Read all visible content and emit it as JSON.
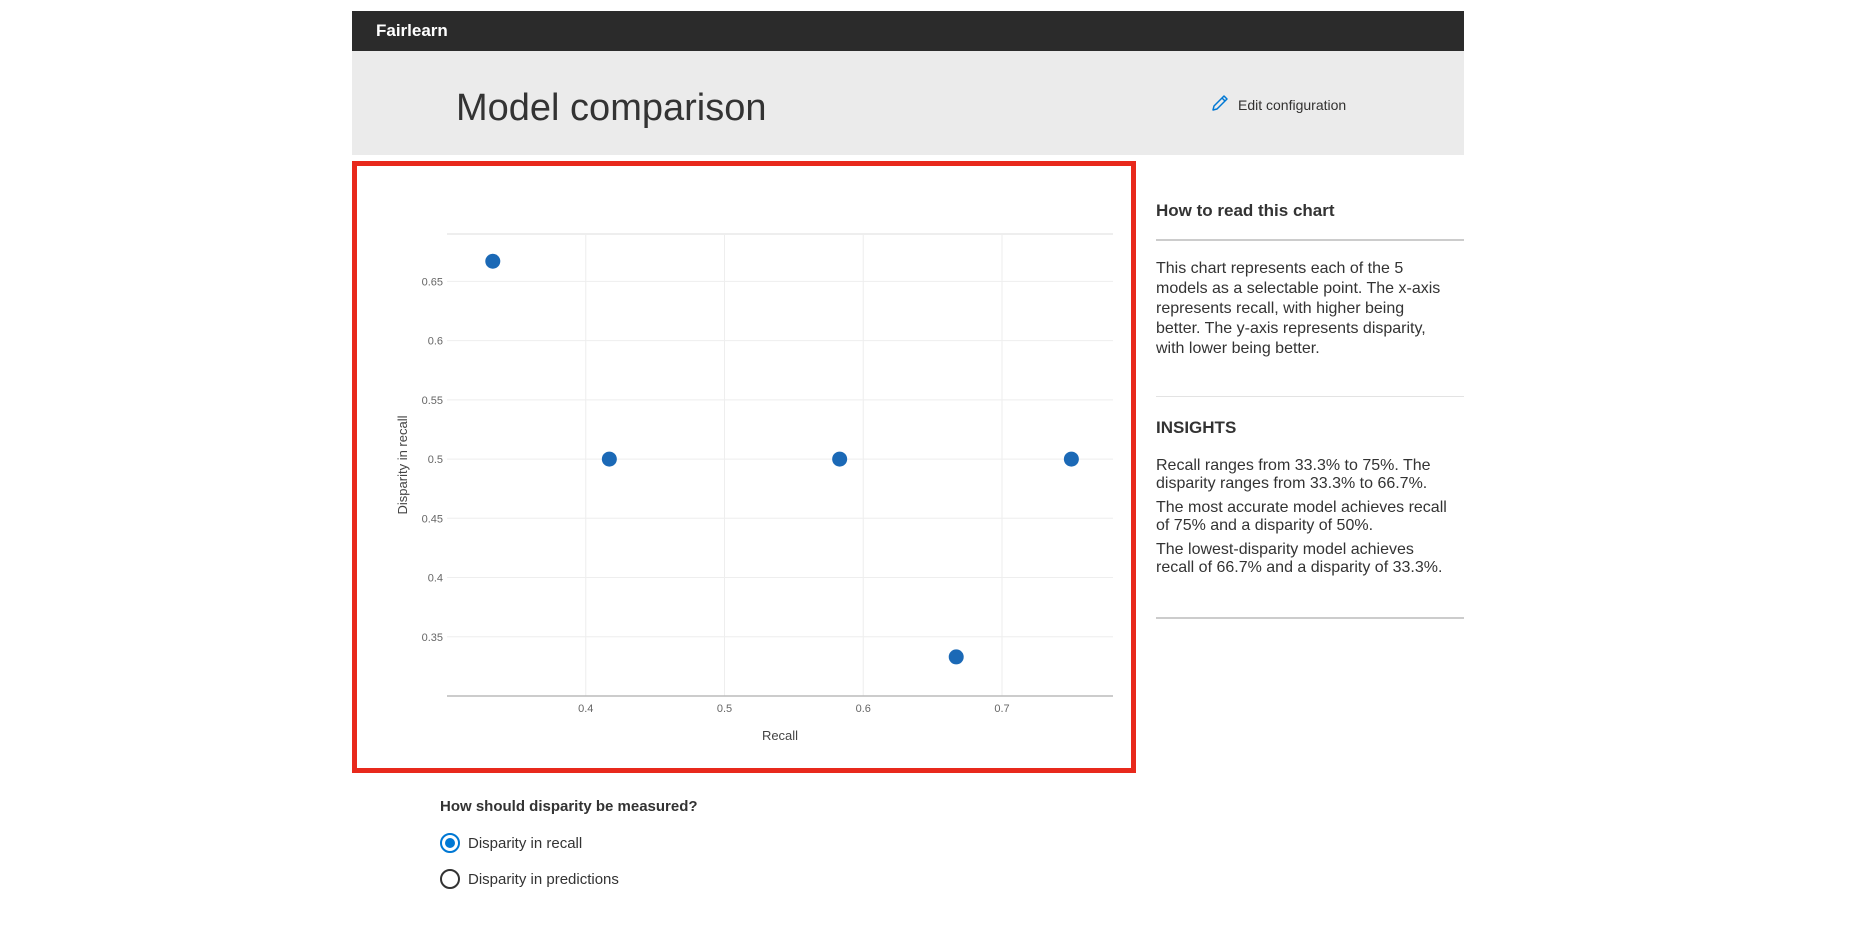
{
  "app": {
    "brand": "Fairlearn"
  },
  "header": {
    "title": "Model comparison",
    "edit_label": "Edit configuration"
  },
  "side": {
    "howto_title": "How to read this chart",
    "howto_text": "This chart represents each of the 5 models as a selectable point. The x-axis represents recall, with higher being better. The y-axis represents disparity, with lower being better.",
    "insights_title": "INSIGHTS",
    "insights": [
      "Recall ranges from 33.3% to 75%. The disparity ranges from 33.3% to 66.7%.",
      "The most accurate model achieves recall of 75% and a disparity of 50%.",
      "The lowest-disparity model achieves recall of 66.7% and a disparity of 33.3%."
    ]
  },
  "measure": {
    "question": "How should disparity be measured?",
    "options": [
      {
        "label": "Disparity in recall",
        "selected": true
      },
      {
        "label": "Disparity in predictions",
        "selected": false
      }
    ]
  },
  "colors": {
    "point": "#1b69b6",
    "highlight": "#e8291c",
    "accent": "#0078d4"
  },
  "chart_data": {
    "type": "scatter",
    "xlabel": "Recall",
    "ylabel": "Disparity in recall",
    "xlim": [
      0.3,
      0.78
    ],
    "ylim": [
      0.3,
      0.69
    ],
    "xticks": [
      0.4,
      0.5,
      0.6,
      0.7
    ],
    "yticks": [
      0.35,
      0.4,
      0.45,
      0.5,
      0.55,
      0.6,
      0.65
    ],
    "points": [
      {
        "x": 0.333,
        "y": 0.667
      },
      {
        "x": 0.417,
        "y": 0.5
      },
      {
        "x": 0.583,
        "y": 0.5
      },
      {
        "x": 0.667,
        "y": 0.333
      },
      {
        "x": 0.75,
        "y": 0.5
      }
    ],
    "grid": true
  }
}
